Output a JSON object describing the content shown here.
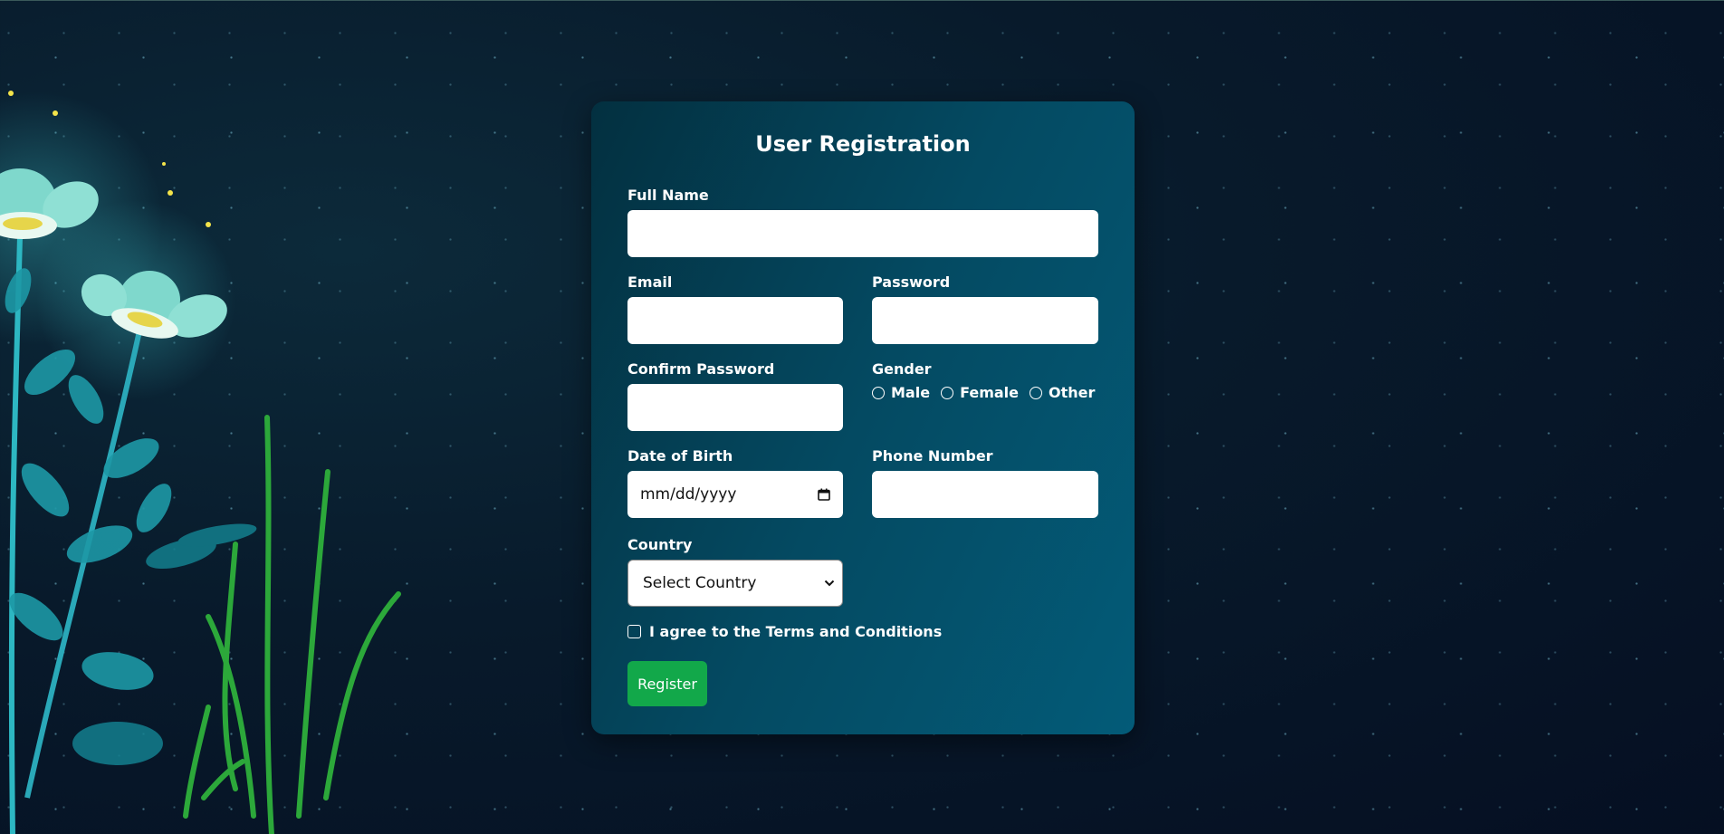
{
  "form": {
    "title": "User Registration",
    "full_name_label": "Full Name",
    "full_name_value": "",
    "email_label": "Email",
    "email_value": "",
    "password_label": "Password",
    "password_value": "",
    "confirm_password_label": "Confirm Password",
    "confirm_password_value": "",
    "gender_label": "Gender",
    "gender_options": [
      "Male",
      "Female",
      "Other"
    ],
    "dob_label": "Date of Birth",
    "dob_placeholder": "mm/dd/yyyy",
    "phone_label": "Phone Number",
    "phone_value": "",
    "country_label": "Country",
    "country_selected": "Select Country",
    "terms_label": "I agree to the Terms and Conditions",
    "register_label": "Register"
  },
  "icons": {
    "calendar": "calendar-icon",
    "chevron": "chevron-down-icon"
  },
  "colors": {
    "background": "#06172a",
    "card": "#044a62",
    "register_button": "#12a84a"
  }
}
